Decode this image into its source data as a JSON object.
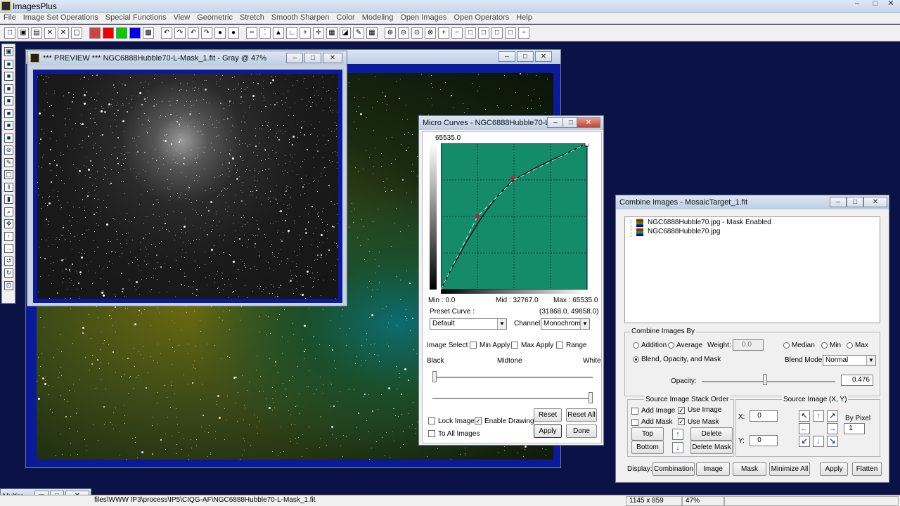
{
  "app": {
    "title": "ImagesPlus"
  },
  "menu": [
    "File",
    "Image Set Operations",
    "Special Functions",
    "View",
    "Geometric",
    "Stretch",
    "Smooth Sharpen",
    "Color",
    "Modeling",
    "Open Images",
    "Open Operators",
    "Help"
  ],
  "toolbar_icons": [
    "new-icon",
    "open-icon",
    "save-icon",
    "close-image-icon",
    "close-all-icon",
    "copy-icon",
    "rgb-icon",
    "red-icon",
    "green-icon",
    "blue-icon",
    "histogram-icon",
    "undo-icon",
    "redo-icon",
    "undo-all-icon",
    "redo-all-icon",
    "record-icon",
    "stop-icon",
    "dots-icon",
    "plot-icon",
    "levels-icon",
    "curves-icon",
    "crosshair-icon",
    "target-icon",
    "grid-icon",
    "image-icon",
    "pencil-icon",
    "table-icon",
    "zoom-in-icon",
    "zoom-out-icon",
    "zoom-fit-icon",
    "zoom-100-icon",
    "plus-icon",
    "minus-icon",
    "box-icon",
    "box2-icon",
    "box3-icon",
    "box4-icon",
    "small-box-icon"
  ],
  "preview_window": {
    "title": "*** PREVIEW *** NGC6888Hubble70-L-Mask_1.fit - Gray @ 47%"
  },
  "micro_curves": {
    "title": "Micro Curves - NGC6888Hubble70-L-...",
    "top_value": "65535.0",
    "min_label": "Min : 0.0",
    "mid_label": "Mid : 32767.0",
    "max_label": "Max : 65535.0",
    "preset_label": "Preset Curve :",
    "point_coords": "(31868.0, 49858.0)",
    "preset_value": "Default",
    "channel_label": "Channel:",
    "channel_value": "Monochrome",
    "image_select": "Image Select",
    "min_apply": "Min Apply",
    "max_apply": "Max Apply",
    "range": "Range",
    "black": "Black",
    "midtone": "Midtone",
    "white": "White",
    "reset": "Reset",
    "reset_all": "Reset All",
    "lock_image": "Lock Image",
    "enable_drawing": "Enable Drawing",
    "to_all_images": "To All Images",
    "apply": "Apply",
    "done": "Done",
    "enable_drawing_checked": true
  },
  "combine": {
    "title": "Combine Images - MosaicTarget_1.fit",
    "list": [
      "NGC6888Hubble70.jpg - Mask Enabled",
      "NGC6888Hubble70.jpg"
    ],
    "group_label": "Combine Images By",
    "addition": "Addition",
    "average": "Average",
    "weight_label": "Weight:",
    "weight_value": "0.0",
    "median": "Median",
    "min": "Min",
    "max": "Max",
    "blend": "Blend, Opacity, and Mask",
    "blend_mode_label": "Blend Mode:",
    "blend_mode_value": "Normal",
    "opacity_label": "Opacity:",
    "opacity_value": "0.476",
    "opacity_fraction": 0.476,
    "stack_label": "Source Image Stack Order",
    "add_image": "Add Image",
    "use_image": "Use Image",
    "add_mask": "Add Mask",
    "use_mask": "Use Mask",
    "top": "Top",
    "bottom": "Bottom",
    "delete_image": "Delete Image",
    "delete_mask": "Delete Mask",
    "x_label": "X:",
    "x_value": "0",
    "y_label": "Y:",
    "y_value": "0",
    "source_xy_label": "Source Image (X, Y)",
    "by_pixel_label": "By Pixel",
    "by_pixel_value": "1",
    "display_label": "Display:",
    "combination": "Combination",
    "image": "Image",
    "mask": "Mask",
    "minimize_all": "Minimize All",
    "apply": "Apply",
    "flatten": "Flatten"
  },
  "minimized": {
    "title": "Multire..."
  },
  "status": {
    "path": "files\\WWW IP3\\process\\IP5\\CIQG-AF\\NGC6888Hubble70-L-Mask_1.fit",
    "dims": "1145 x 859",
    "zoom": "47%"
  }
}
